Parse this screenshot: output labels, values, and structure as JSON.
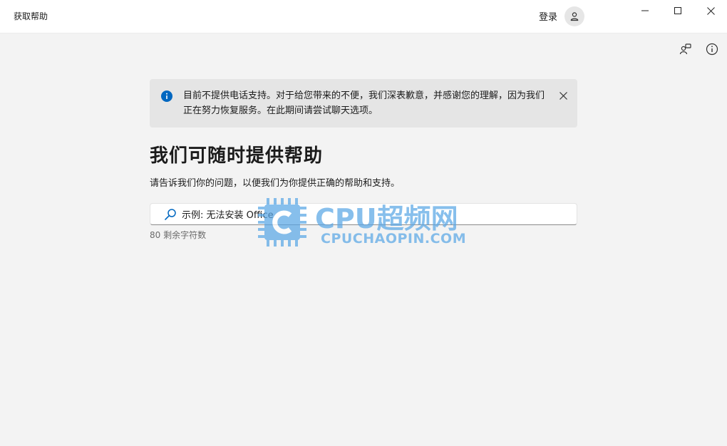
{
  "window": {
    "title": "获取帮助",
    "signin_label": "登录"
  },
  "banner": {
    "message": "目前不提供电话支持。对于给您带来的不便，我们深表歉意，并感谢您的理解，因为我们正在努力恢复服务。在此期间请尝试聊天选项。"
  },
  "main": {
    "heading": "我们可随时提供帮助",
    "subtext": "请告诉我们你的问题，以便我们为你提供正确的帮助和支持。",
    "search_placeholder": "示例: 无法安装 Office",
    "search_value": "",
    "char_counter": "80 剩余字符数"
  },
  "watermark": {
    "brand_big": "CPU超频网",
    "brand_small": "CPUCHAOPIN.COM"
  },
  "colors": {
    "accent": "#0067c0",
    "watermark": "#5aa7e6"
  },
  "icons": [
    "person-icon",
    "minimize-icon",
    "maximize-icon",
    "close-icon",
    "feedback-icon",
    "info-icon",
    "info-filled-icon",
    "dismiss-icon",
    "search-icon"
  ]
}
